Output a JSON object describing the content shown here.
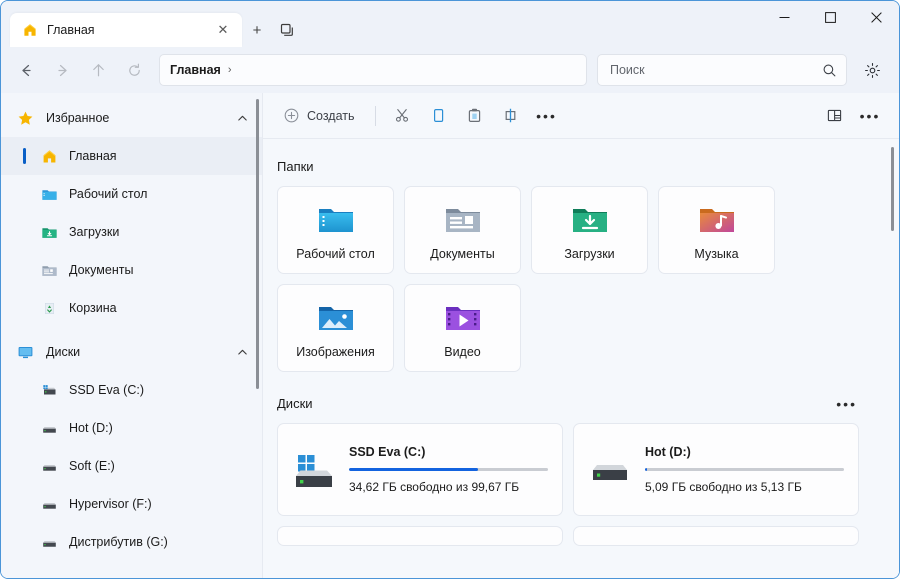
{
  "window": {
    "accent_color": "#0a5fc6",
    "titlebar_bg": "#eef2f9",
    "content_bg": "#f5f8fc"
  },
  "titlebar": {
    "tab": {
      "title": "Главная",
      "icon": "home-icon",
      "close_label": "✕"
    },
    "new_tab_label": "+",
    "tab_list_icon": "tab-list-icon",
    "controls": {
      "minimize": "—",
      "maximize": "▢",
      "close": "✕"
    }
  },
  "navbar": {
    "back_label": "←",
    "forward_label": "→",
    "up_label": "↑",
    "refresh_label": "⟳",
    "breadcrumb": {
      "path": "Главная",
      "separator": "›"
    },
    "search": {
      "placeholder": "Поиск",
      "value": "",
      "icon": "search-icon"
    },
    "settings_icon": "gear-icon"
  },
  "toolbar": {
    "new_label": "Создать",
    "cut_icon": "scissors-icon",
    "copy_icon": "copy-icon",
    "paste_icon": "paste-icon",
    "rename_icon": "rename-icon",
    "more_label": "•••",
    "view_icon": "layout-view-icon",
    "options_label": "•••"
  },
  "sidebar": {
    "groups": [
      {
        "label": "Избранное",
        "icon": "star-icon",
        "chevron": "⌃",
        "items": [
          {
            "label": "Главная",
            "icon": "home-icon",
            "selected": true
          },
          {
            "label": "Рабочий стол",
            "icon": "desktop-folder-icon",
            "selected": false
          },
          {
            "label": "Загрузки",
            "icon": "downloads-folder-icon",
            "selected": false
          },
          {
            "label": "Документы",
            "icon": "documents-folder-icon",
            "selected": false
          },
          {
            "label": "Корзина",
            "icon": "recycle-bin-icon",
            "selected": false
          }
        ]
      },
      {
        "label": "Диски",
        "icon": "monitor-icon",
        "chevron": "⌃",
        "items": [
          {
            "label": "SSD Eva (C:)",
            "icon": "system-drive-icon",
            "selected": false
          },
          {
            "label": "Hot (D:)",
            "icon": "drive-icon",
            "selected": false
          },
          {
            "label": "Soft (E:)",
            "icon": "drive-icon",
            "selected": false
          },
          {
            "label": "Hypervisor (F:)",
            "icon": "drive-icon",
            "selected": false
          },
          {
            "label": "Дистрибутив (G:)",
            "icon": "drive-icon",
            "selected": false
          }
        ]
      }
    ]
  },
  "main": {
    "folders_section": {
      "title": "Папки",
      "items": [
        {
          "name": "Рабочий стол",
          "icon": "desktop-folder-icon"
        },
        {
          "name": "Документы",
          "icon": "documents-folder-icon"
        },
        {
          "name": "Загрузки",
          "icon": "downloads-folder-icon"
        },
        {
          "name": "Музыка",
          "icon": "music-folder-icon"
        },
        {
          "name": "Изображения",
          "icon": "pictures-folder-icon"
        },
        {
          "name": "Видео",
          "icon": "video-folder-icon"
        }
      ]
    },
    "drives_section": {
      "title": "Диски",
      "more_label": "•••",
      "items": [
        {
          "name": "SSD Eva (C:)",
          "capacity_text": "34,62 ГБ свободно из 99,67 ГБ",
          "used_percent": 65,
          "bar_color": "#1363df",
          "icon": "system-drive-icon"
        },
        {
          "name": "Hot (D:)",
          "capacity_text": "5,09 ГБ свободно из 5,13 ГБ",
          "used_percent": 1,
          "bar_color": "#1363df",
          "icon": "drive-icon"
        }
      ]
    }
  }
}
